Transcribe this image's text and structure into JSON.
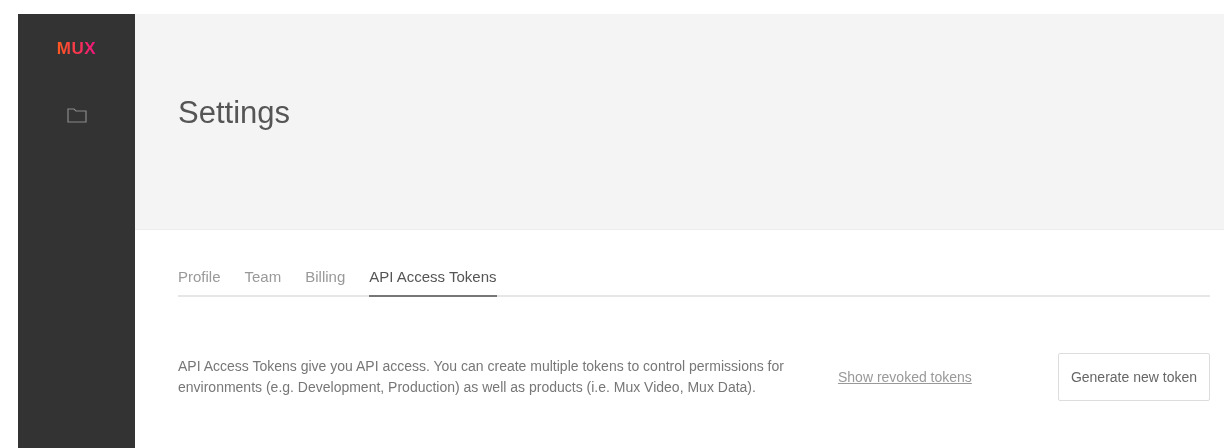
{
  "sidebar": {
    "logo": "MUX"
  },
  "header": {
    "title": "Settings"
  },
  "tabs": [
    {
      "label": "Profile",
      "selected": false
    },
    {
      "label": "Team",
      "selected": false
    },
    {
      "label": "Billing",
      "selected": false
    },
    {
      "label": "API Access Tokens",
      "selected": true
    }
  ],
  "description": "API Access Tokens give you API access. You can create multiple tokens to control permissions for environments (e.g. Development, Production) as well as products (i.e. Mux Video, Mux Data).",
  "link": "Show revoked tokens",
  "button": "Generate new token"
}
